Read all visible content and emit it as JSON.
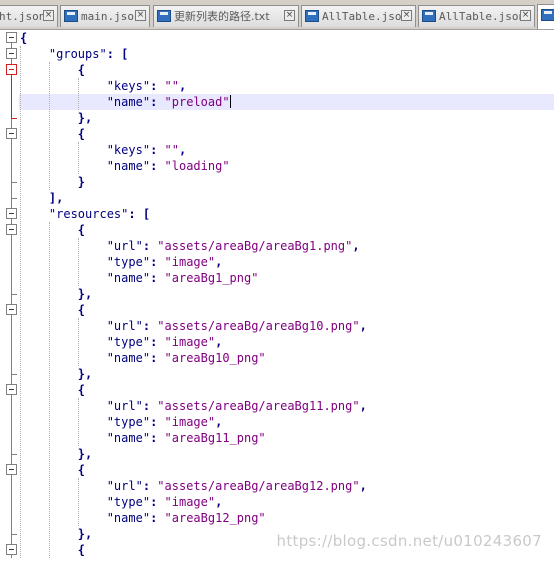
{
  "tabs": [
    {
      "label": "ht.json",
      "active": false,
      "has_icon": false
    },
    {
      "label": "main.json",
      "active": false,
      "has_icon": true
    },
    {
      "label": "更新列表的路径.txt",
      "active": false,
      "has_icon": true
    },
    {
      "label": "AllTable.json",
      "active": false,
      "has_icon": true
    },
    {
      "label": "AllTable.json",
      "active": false,
      "has_icon": true
    },
    {
      "label": "",
      "active": true,
      "has_icon": true
    }
  ],
  "editor": {
    "lines": [
      "{",
      "    \"groups\": [",
      "        {",
      "            \"keys\": \"\",",
      "            \"name\": \"preload\"",
      "        },",
      "        {",
      "            \"keys\": \"\",",
      "            \"name\": \"loading\"",
      "        }",
      "    ],",
      "    \"resources\": [",
      "        {",
      "            \"url\": \"assets/areaBg/areaBg1.png\",",
      "            \"type\": \"image\",",
      "            \"name\": \"areaBg1_png\"",
      "        },",
      "        {",
      "            \"url\": \"assets/areaBg/areaBg10.png\",",
      "            \"type\": \"image\",",
      "            \"name\": \"areaBg10_png\"",
      "        },",
      "        {",
      "            \"url\": \"assets/areaBg/areaBg11.png\",",
      "            \"type\": \"image\",",
      "            \"name\": \"areaBg11_png\"",
      "        },",
      "        {",
      "            \"url\": \"assets/areaBg/areaBg12.png\",",
      "            \"type\": \"image\",",
      "            \"name\": \"areaBg12_png\"",
      "        },",
      "        {"
    ],
    "current_line_index": 4
  },
  "watermark": "https://blog.csdn.net/u010243607",
  "colors": {
    "key": "#000080",
    "string": "#800080",
    "current_line": "#e8e8ff",
    "fold_active": "#d02020"
  },
  "icons": {
    "tab": "file-save-icon",
    "close": "close-icon",
    "fold": "fold-minus-icon"
  }
}
